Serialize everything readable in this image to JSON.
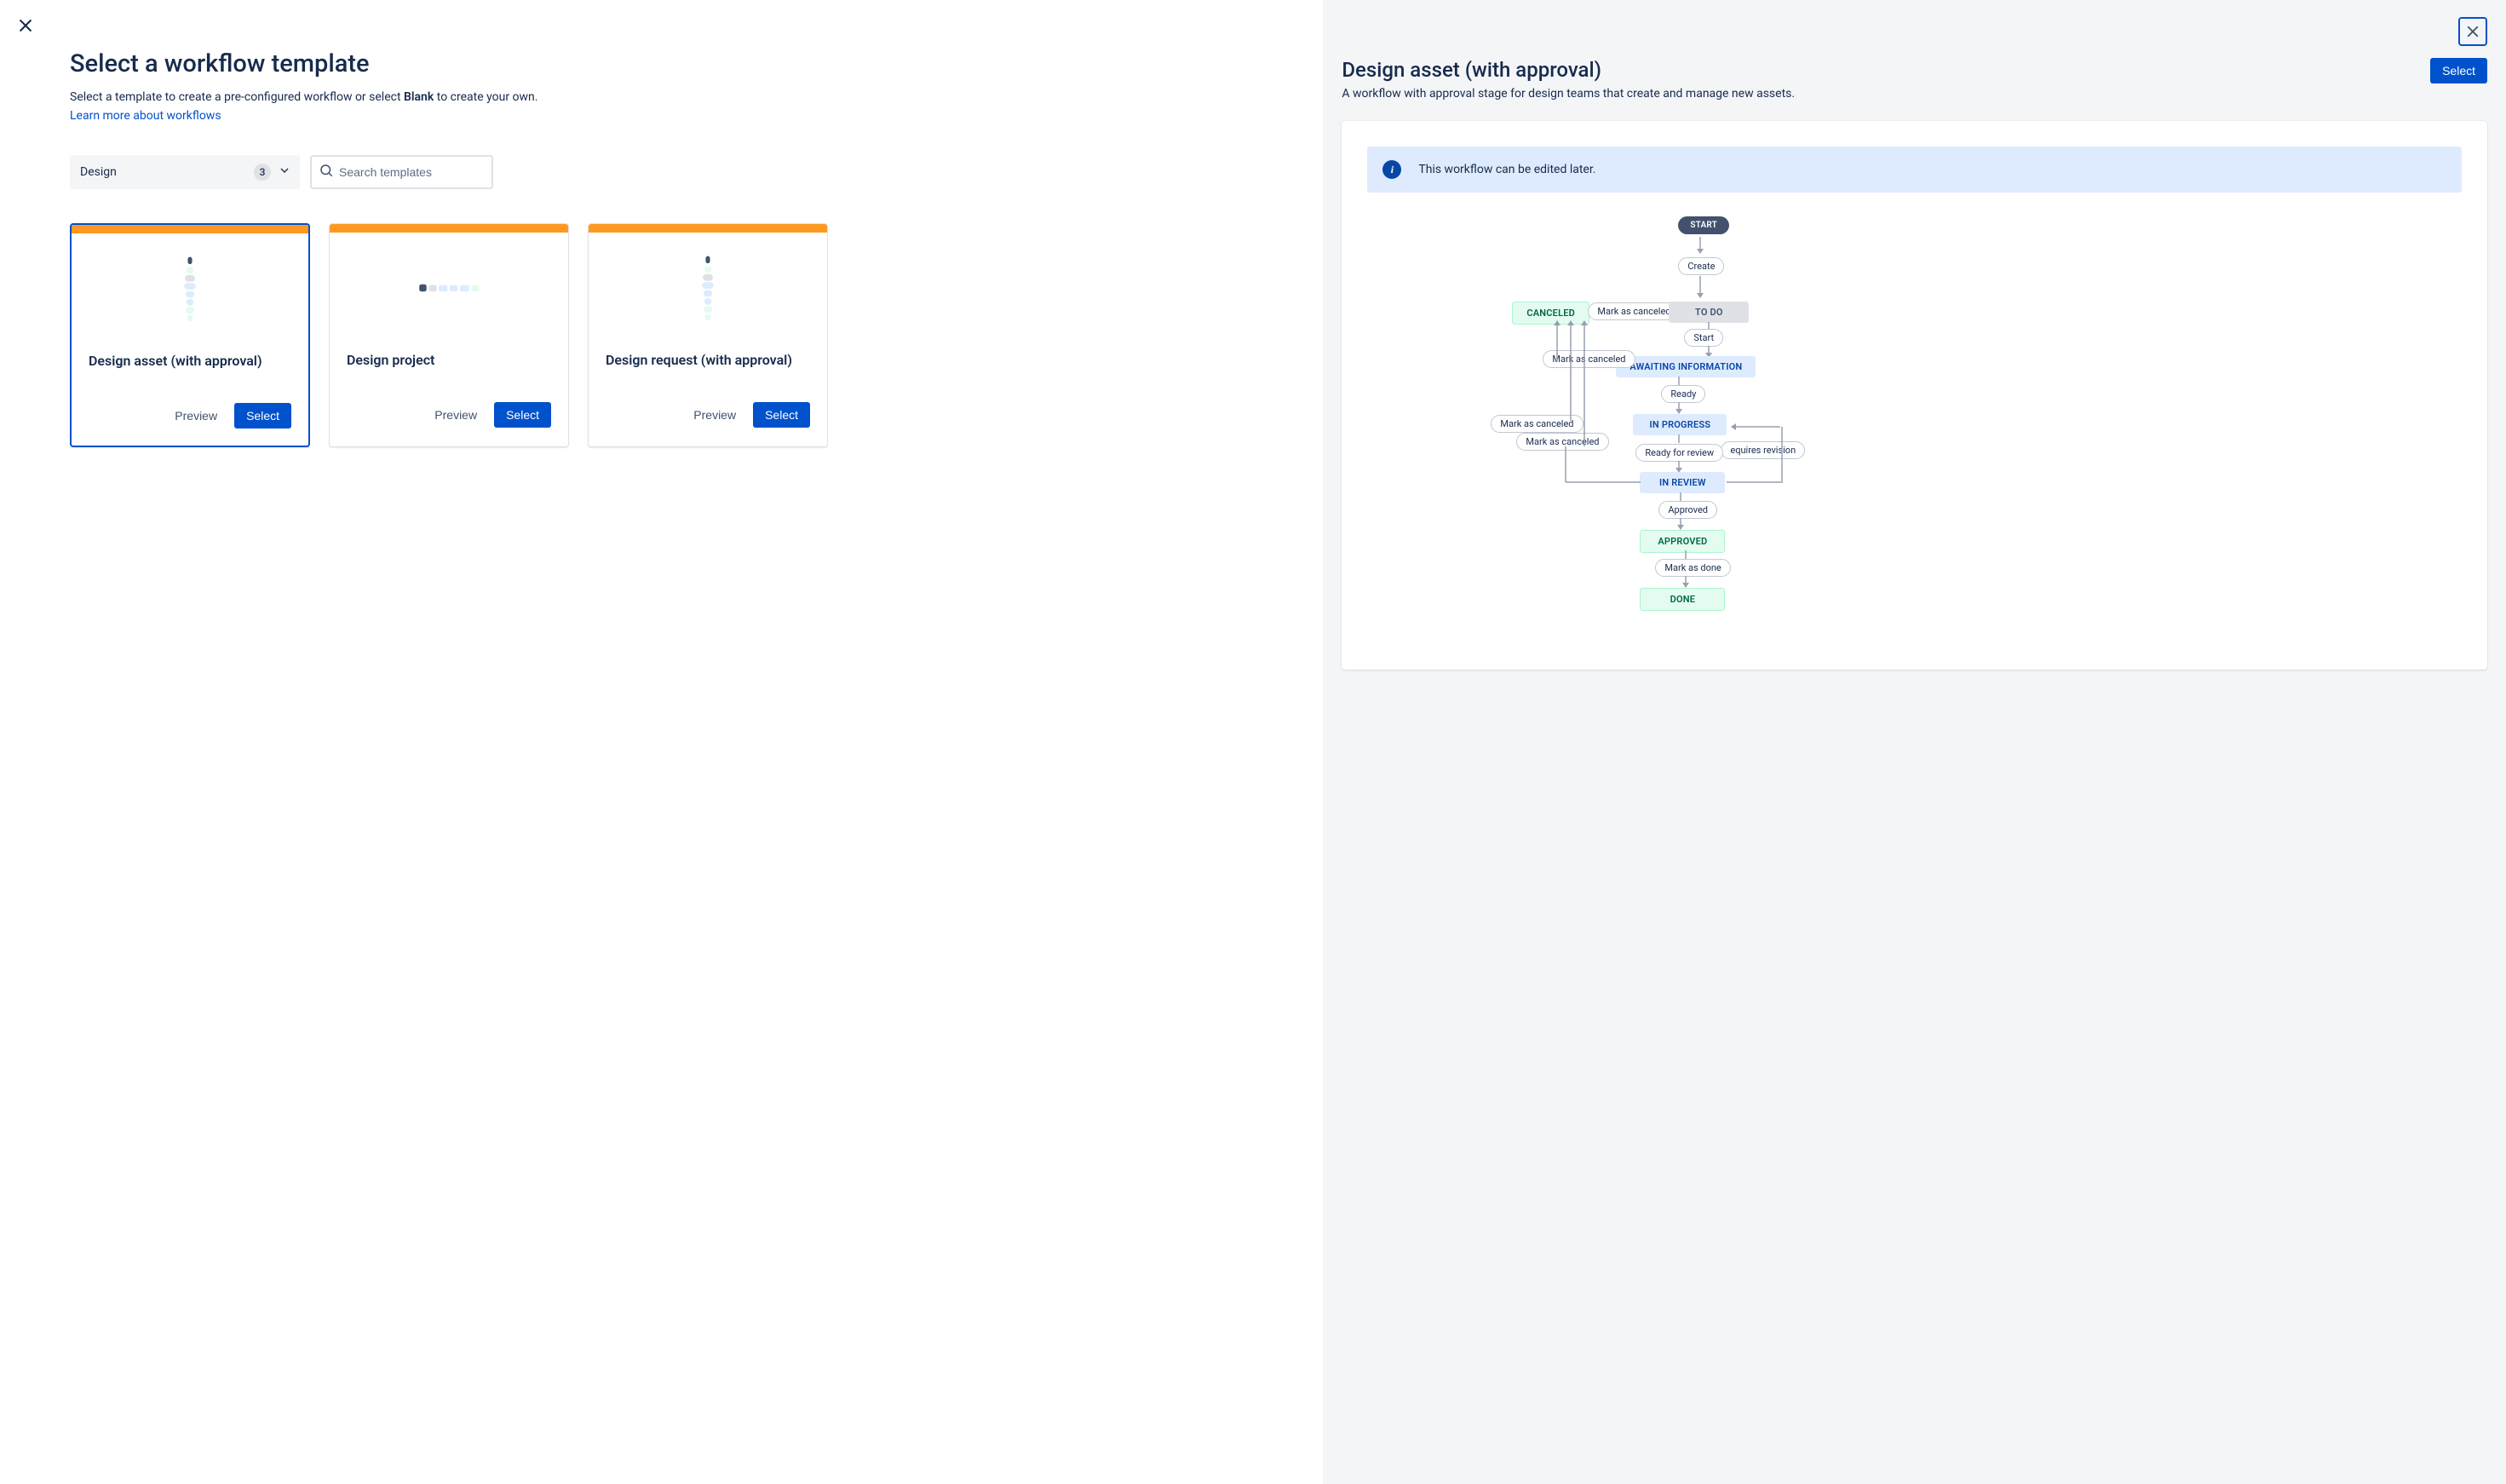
{
  "left": {
    "title": "Select a workflow template",
    "subtitle_pre": "Select a template to create a pre-configured workflow or select ",
    "subtitle_bold": "Blank",
    "subtitle_post": " to create your own.",
    "learn_link": "Learn more about workflows",
    "filters": {
      "category_label": "Design",
      "category_count": "3",
      "search_placeholder": "Search templates"
    },
    "cards": [
      {
        "title": "Design asset (with approval)",
        "preview_label": "Preview",
        "select_label": "Select",
        "selected": true
      },
      {
        "title": "Design project",
        "preview_label": "Preview",
        "select_label": "Select",
        "selected": false
      },
      {
        "title": "Design request (with approval)",
        "preview_label": "Preview",
        "select_label": "Select",
        "selected": false
      }
    ]
  },
  "right": {
    "title": "Design asset (with approval)",
    "description": "A workflow with approval stage for design teams that create and manage new assets.",
    "select_label": "Select",
    "info_text": "This workflow can be edited later.",
    "workflow": {
      "start": "START",
      "transitions": {
        "create": "Create",
        "mark_as_canceled": "Mark as canceled",
        "start_t": "Start",
        "ready": "Ready",
        "ready_for_review": "Ready for review",
        "requires_revision": "equires revision",
        "approved": "Approved",
        "mark_as_done": "Mark as done"
      },
      "statuses": {
        "canceled": "CANCELED",
        "todo": "TO DO",
        "awaiting": "AWAITING INFORMATION",
        "in_progress": "IN PROGRESS",
        "in_review": "IN REVIEW",
        "approved": "APPROVED",
        "done": "DONE"
      }
    }
  }
}
